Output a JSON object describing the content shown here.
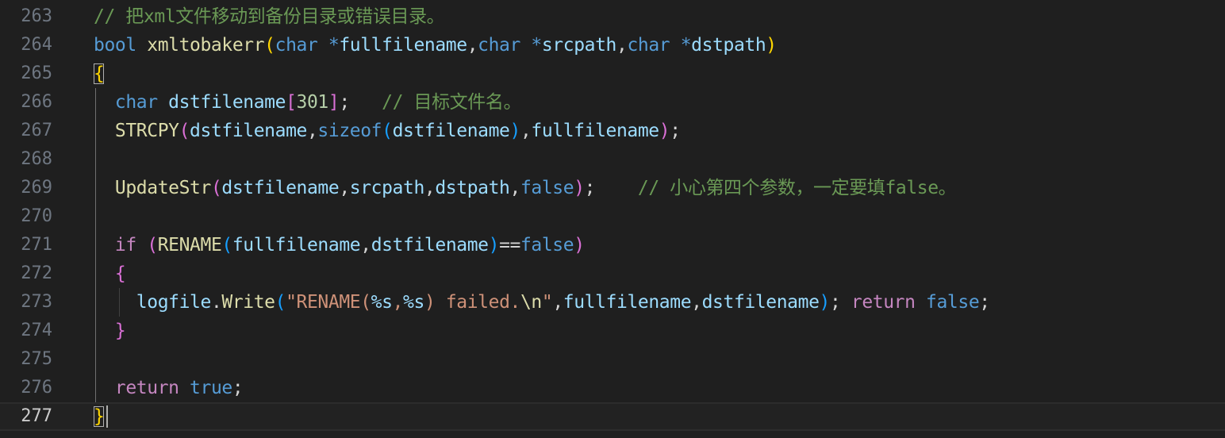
{
  "colors": {
    "background": "#1f1f1f",
    "keyword": "#569cd6",
    "control": "#c586c0",
    "function": "#dcdcaa",
    "variable": "#9cdcfe",
    "string": "#ce9178",
    "number": "#b5cea8",
    "comment": "#6a9955",
    "default": "#d4d4d4",
    "bracket1": "#ffd700",
    "bracket2": "#da70d6",
    "bracket3": "#179fff"
  },
  "current_line": 277,
  "lines": [
    {
      "num": 263,
      "tokens": [
        {
          "t": "// 把xml文件移动到备份目录或错误目录。",
          "c": "comment"
        }
      ]
    },
    {
      "num": 264,
      "tokens": [
        {
          "t": "bool",
          "c": "keyword"
        },
        {
          "t": " ",
          "c": "default"
        },
        {
          "t": "xmltobakerr",
          "c": "function"
        },
        {
          "t": "(",
          "c": "bracket1"
        },
        {
          "t": "char",
          "c": "keyword"
        },
        {
          "t": " ",
          "c": "default"
        },
        {
          "t": "*",
          "c": "keyword"
        },
        {
          "t": "fullfilename",
          "c": "variable"
        },
        {
          "t": ",",
          "c": "default"
        },
        {
          "t": "char",
          "c": "keyword"
        },
        {
          "t": " ",
          "c": "default"
        },
        {
          "t": "*",
          "c": "keyword"
        },
        {
          "t": "srcpath",
          "c": "variable"
        },
        {
          "t": ",",
          "c": "default"
        },
        {
          "t": "char",
          "c": "keyword"
        },
        {
          "t": " ",
          "c": "default"
        },
        {
          "t": "*",
          "c": "keyword"
        },
        {
          "t": "dstpath",
          "c": "variable"
        },
        {
          "t": ")",
          "c": "bracket1"
        }
      ]
    },
    {
      "num": 265,
      "tokens": [
        {
          "t": "{",
          "c": "bracket1"
        }
      ]
    },
    {
      "num": 266,
      "tokens": [
        {
          "t": "  ",
          "c": "default"
        },
        {
          "t": "char",
          "c": "keyword"
        },
        {
          "t": " ",
          "c": "default"
        },
        {
          "t": "dstfilename",
          "c": "variable"
        },
        {
          "t": "[",
          "c": "bracket2"
        },
        {
          "t": "301",
          "c": "number"
        },
        {
          "t": "]",
          "c": "bracket2"
        },
        {
          "t": ";",
          "c": "default"
        },
        {
          "t": "   ",
          "c": "default"
        },
        {
          "t": "// 目标文件名。",
          "c": "comment"
        }
      ]
    },
    {
      "num": 267,
      "tokens": [
        {
          "t": "  ",
          "c": "default"
        },
        {
          "t": "STRCPY",
          "c": "function"
        },
        {
          "t": "(",
          "c": "bracket2"
        },
        {
          "t": "dstfilename",
          "c": "variable"
        },
        {
          "t": ",",
          "c": "default"
        },
        {
          "t": "sizeof",
          "c": "keyword"
        },
        {
          "t": "(",
          "c": "bracket3"
        },
        {
          "t": "dstfilename",
          "c": "variable"
        },
        {
          "t": ")",
          "c": "bracket3"
        },
        {
          "t": ",",
          "c": "default"
        },
        {
          "t": "fullfilename",
          "c": "variable"
        },
        {
          "t": ")",
          "c": "bracket2"
        },
        {
          "t": ";",
          "c": "default"
        }
      ]
    },
    {
      "num": 268,
      "tokens": []
    },
    {
      "num": 269,
      "tokens": [
        {
          "t": "  ",
          "c": "default"
        },
        {
          "t": "UpdateStr",
          "c": "function"
        },
        {
          "t": "(",
          "c": "bracket2"
        },
        {
          "t": "dstfilename",
          "c": "variable"
        },
        {
          "t": ",",
          "c": "default"
        },
        {
          "t": "srcpath",
          "c": "variable"
        },
        {
          "t": ",",
          "c": "default"
        },
        {
          "t": "dstpath",
          "c": "variable"
        },
        {
          "t": ",",
          "c": "default"
        },
        {
          "t": "false",
          "c": "keyword"
        },
        {
          "t": ")",
          "c": "bracket2"
        },
        {
          "t": ";",
          "c": "default"
        },
        {
          "t": "    ",
          "c": "default"
        },
        {
          "t": "// 小心第四个参数，一定要填false。",
          "c": "comment"
        }
      ]
    },
    {
      "num": 270,
      "tokens": []
    },
    {
      "num": 271,
      "tokens": [
        {
          "t": "  ",
          "c": "default"
        },
        {
          "t": "if",
          "c": "control"
        },
        {
          "t": " ",
          "c": "default"
        },
        {
          "t": "(",
          "c": "bracket2"
        },
        {
          "t": "RENAME",
          "c": "function"
        },
        {
          "t": "(",
          "c": "bracket3"
        },
        {
          "t": "fullfilename",
          "c": "variable"
        },
        {
          "t": ",",
          "c": "default"
        },
        {
          "t": "dstfilename",
          "c": "variable"
        },
        {
          "t": ")",
          "c": "bracket3"
        },
        {
          "t": "==",
          "c": "default"
        },
        {
          "t": "false",
          "c": "keyword"
        },
        {
          "t": ")",
          "c": "bracket2"
        }
      ]
    },
    {
      "num": 272,
      "tokens": [
        {
          "t": "  ",
          "c": "default"
        },
        {
          "t": "{",
          "c": "bracket2"
        }
      ]
    },
    {
      "num": 273,
      "tokens": [
        {
          "t": "    ",
          "c": "default"
        },
        {
          "t": "logfile",
          "c": "variable"
        },
        {
          "t": ".",
          "c": "default"
        },
        {
          "t": "Write",
          "c": "function"
        },
        {
          "t": "(",
          "c": "bracket3"
        },
        {
          "t": "\"RENAME(",
          "c": "string"
        },
        {
          "t": "%s",
          "c": "variable"
        },
        {
          "t": ",",
          "c": "string"
        },
        {
          "t": "%s",
          "c": "variable"
        },
        {
          "t": ") failed.",
          "c": "string"
        },
        {
          "t": "\\n",
          "c": "function"
        },
        {
          "t": "\"",
          "c": "string"
        },
        {
          "t": ",",
          "c": "default"
        },
        {
          "t": "fullfilename",
          "c": "variable"
        },
        {
          "t": ",",
          "c": "default"
        },
        {
          "t": "dstfilename",
          "c": "variable"
        },
        {
          "t": ")",
          "c": "bracket3"
        },
        {
          "t": ";",
          "c": "default"
        },
        {
          "t": " ",
          "c": "default"
        },
        {
          "t": "return",
          "c": "control"
        },
        {
          "t": " ",
          "c": "default"
        },
        {
          "t": "false",
          "c": "keyword"
        },
        {
          "t": ";",
          "c": "default"
        }
      ]
    },
    {
      "num": 274,
      "tokens": [
        {
          "t": "  ",
          "c": "default"
        },
        {
          "t": "}",
          "c": "bracket2"
        }
      ]
    },
    {
      "num": 275,
      "tokens": []
    },
    {
      "num": 276,
      "tokens": [
        {
          "t": "  ",
          "c": "default"
        },
        {
          "t": "return",
          "c": "control"
        },
        {
          "t": " ",
          "c": "default"
        },
        {
          "t": "true",
          "c": "keyword"
        },
        {
          "t": ";",
          "c": "default"
        }
      ]
    },
    {
      "num": 277,
      "tokens": [
        {
          "t": "}",
          "c": "bracket1"
        }
      ]
    }
  ]
}
